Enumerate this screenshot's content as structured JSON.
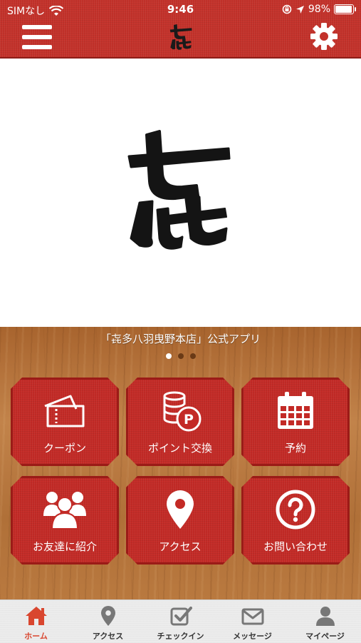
{
  "status_bar": {
    "carrier": "SIMなし",
    "time": "9:46",
    "battery_percent": "98%",
    "battery_level": 0.98
  },
  "header": {
    "menu_icon": "hamburger-menu-icon",
    "settings_icon": "gear-icon",
    "logo": "brand-logo"
  },
  "hero": {
    "logo": "brand-logo-large"
  },
  "main": {
    "tagline": "「㐂多八羽曳野本店」公式アプリ",
    "carousel_page": 1,
    "carousel_pages": 3,
    "tiles": [
      {
        "label": "クーポン",
        "icon": "ticket-icon"
      },
      {
        "label": "ポイント交換",
        "icon": "coins-icon"
      },
      {
        "label": "予約",
        "icon": "calendar-icon"
      },
      {
        "label": "お友達に紹介",
        "icon": "people-icon"
      },
      {
        "label": "アクセス",
        "icon": "map-pin-icon"
      },
      {
        "label": "お問い合わせ",
        "icon": "question-icon"
      }
    ]
  },
  "tabbar": {
    "items": [
      {
        "label": "ホーム",
        "icon": "home-icon",
        "active": true
      },
      {
        "label": "アクセス",
        "icon": "map-pin-icon",
        "active": false
      },
      {
        "label": "チェックイン",
        "icon": "checkin-icon",
        "active": false
      },
      {
        "label": "メッセージ",
        "icon": "mail-icon",
        "active": false
      },
      {
        "label": "マイページ",
        "icon": "user-icon",
        "active": false
      }
    ]
  },
  "colors": {
    "brand_red": "#c32a26",
    "active_tab": "#d9462f",
    "wood": "#b5763b"
  }
}
